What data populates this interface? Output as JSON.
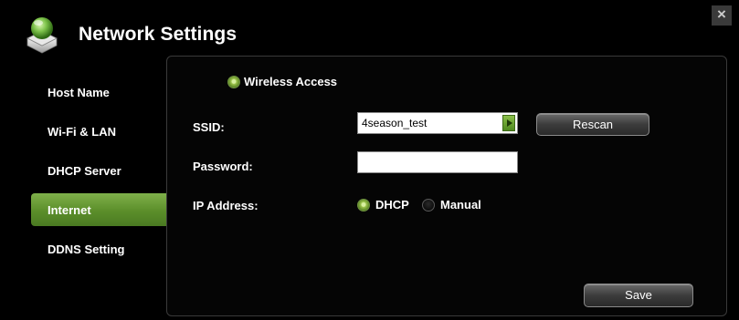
{
  "window": {
    "title": "Network Settings",
    "close_label": "×"
  },
  "sidebar": {
    "items": [
      {
        "label": "Host Name",
        "active": false
      },
      {
        "label": "Wi-Fi & LAN",
        "active": false
      },
      {
        "label": "DHCP Server",
        "active": false
      },
      {
        "label": "Internet",
        "active": true
      },
      {
        "label": "DDNS Setting",
        "active": false
      }
    ]
  },
  "internet": {
    "wireless_access_label": "Wireless Access",
    "ssid_label": "SSID:",
    "ssid_value": "4season_test",
    "rescan_label": "Rescan",
    "password_label": "Password:",
    "password_value": "",
    "ip_address_label": "IP Address:",
    "ip_options": [
      {
        "label": "DHCP",
        "selected": true
      },
      {
        "label": "Manual",
        "selected": false
      }
    ],
    "save_label": "Save"
  },
  "colors": {
    "accent_green": "#6b9e36",
    "background": "#000000",
    "panel_border": "#3a3a3a"
  }
}
